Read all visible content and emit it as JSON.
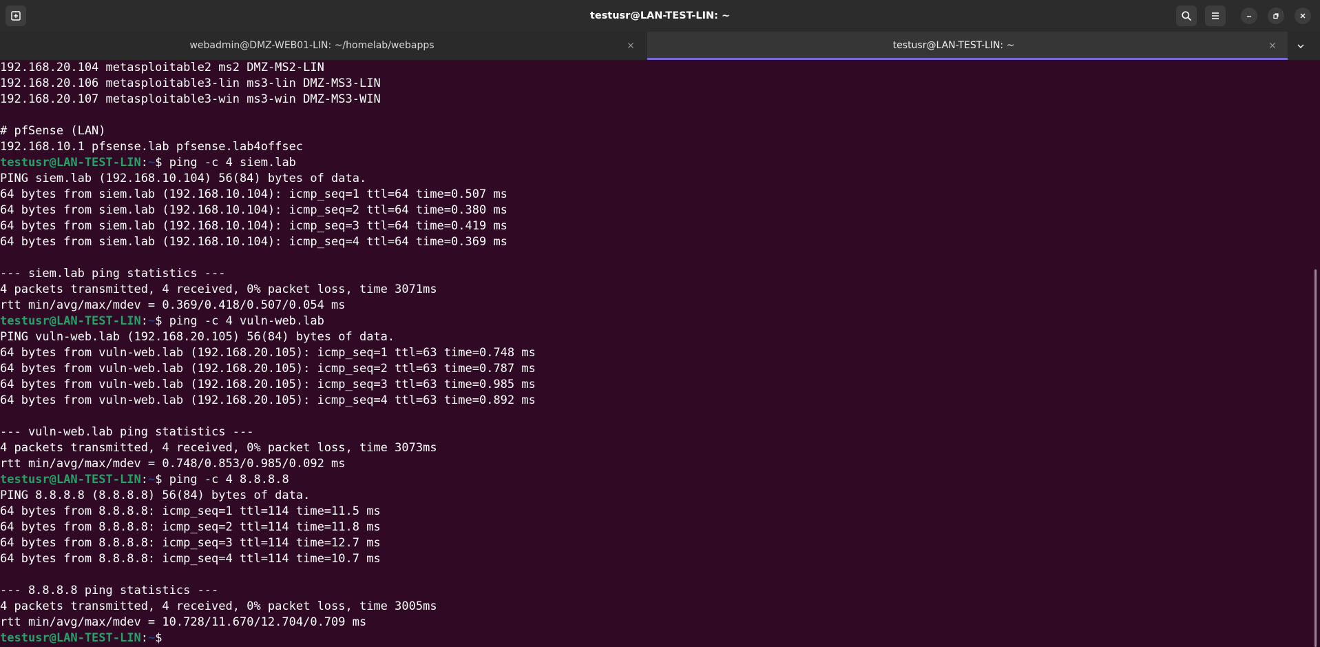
{
  "window": {
    "title": "testusr@LAN-TEST-LIN: ~"
  },
  "tabs": [
    {
      "label": "webadmin@DMZ-WEB01-LIN: ~/homelab/webapps",
      "active": false
    },
    {
      "label": "testusr@LAN-TEST-LIN: ~",
      "active": true
    }
  ],
  "icons": {
    "new_tab": "new-tab-icon",
    "search": "search-icon",
    "menu": "hamburger-menu-icon",
    "minimize": "minimize-icon",
    "maximize": "restore-icon",
    "close": "close-icon",
    "tab_close": "close-icon",
    "tab_overflow": "chevron-down-icon"
  },
  "colors": {
    "terminal_bg": "#300a24",
    "prompt_user": "#26a269",
    "prompt_path": "#12488b",
    "active_tab_indicator": "#7b68d8"
  },
  "prompt": {
    "user_host": "testusr@LAN-TEST-LIN",
    "separator": ":",
    "path": "~",
    "symbol": "$ "
  },
  "terminal": {
    "lines": [
      {
        "type": "out",
        "text": "192.168.20.104 metasploitable2 ms2 DMZ-MS2-LIN"
      },
      {
        "type": "out",
        "text": "192.168.20.106 metasploitable3-lin ms3-lin DMZ-MS3-LIN"
      },
      {
        "type": "out",
        "text": "192.168.20.107 metasploitable3-win ms3-win DMZ-MS3-WIN"
      },
      {
        "type": "out",
        "text": ""
      },
      {
        "type": "out",
        "text": "# pfSense (LAN)"
      },
      {
        "type": "out",
        "text": "192.168.10.1 pfsense.lab pfsense.lab4offsec"
      },
      {
        "type": "cmd",
        "text": "ping -c 4 siem.lab"
      },
      {
        "type": "out",
        "text": "PING siem.lab (192.168.10.104) 56(84) bytes of data."
      },
      {
        "type": "out",
        "text": "64 bytes from siem.lab (192.168.10.104): icmp_seq=1 ttl=64 time=0.507 ms"
      },
      {
        "type": "out",
        "text": "64 bytes from siem.lab (192.168.10.104): icmp_seq=2 ttl=64 time=0.380 ms"
      },
      {
        "type": "out",
        "text": "64 bytes from siem.lab (192.168.10.104): icmp_seq=3 ttl=64 time=0.419 ms"
      },
      {
        "type": "out",
        "text": "64 bytes from siem.lab (192.168.10.104): icmp_seq=4 ttl=64 time=0.369 ms"
      },
      {
        "type": "out",
        "text": ""
      },
      {
        "type": "out",
        "text": "--- siem.lab ping statistics ---"
      },
      {
        "type": "out",
        "text": "4 packets transmitted, 4 received, 0% packet loss, time 3071ms"
      },
      {
        "type": "out",
        "text": "rtt min/avg/max/mdev = 0.369/0.418/0.507/0.054 ms"
      },
      {
        "type": "cmd",
        "text": "ping -c 4 vuln-web.lab"
      },
      {
        "type": "out",
        "text": "PING vuln-web.lab (192.168.20.105) 56(84) bytes of data."
      },
      {
        "type": "out",
        "text": "64 bytes from vuln-web.lab (192.168.20.105): icmp_seq=1 ttl=63 time=0.748 ms"
      },
      {
        "type": "out",
        "text": "64 bytes from vuln-web.lab (192.168.20.105): icmp_seq=2 ttl=63 time=0.787 ms"
      },
      {
        "type": "out",
        "text": "64 bytes from vuln-web.lab (192.168.20.105): icmp_seq=3 ttl=63 time=0.985 ms"
      },
      {
        "type": "out",
        "text": "64 bytes from vuln-web.lab (192.168.20.105): icmp_seq=4 ttl=63 time=0.892 ms"
      },
      {
        "type": "out",
        "text": ""
      },
      {
        "type": "out",
        "text": "--- vuln-web.lab ping statistics ---"
      },
      {
        "type": "out",
        "text": "4 packets transmitted, 4 received, 0% packet loss, time 3073ms"
      },
      {
        "type": "out",
        "text": "rtt min/avg/max/mdev = 0.748/0.853/0.985/0.092 ms"
      },
      {
        "type": "cmd",
        "text": "ping -c 4 8.8.8.8"
      },
      {
        "type": "out",
        "text": "PING 8.8.8.8 (8.8.8.8) 56(84) bytes of data."
      },
      {
        "type": "out",
        "text": "64 bytes from 8.8.8.8: icmp_seq=1 ttl=114 time=11.5 ms"
      },
      {
        "type": "out",
        "text": "64 bytes from 8.8.8.8: icmp_seq=2 ttl=114 time=11.8 ms"
      },
      {
        "type": "out",
        "text": "64 bytes from 8.8.8.8: icmp_seq=3 ttl=114 time=12.7 ms"
      },
      {
        "type": "out",
        "text": "64 bytes from 8.8.8.8: icmp_seq=4 ttl=114 time=10.7 ms"
      },
      {
        "type": "out",
        "text": ""
      },
      {
        "type": "out",
        "text": "--- 8.8.8.8 ping statistics ---"
      },
      {
        "type": "out",
        "text": "4 packets transmitted, 4 received, 0% packet loss, time 3005ms"
      },
      {
        "type": "out",
        "text": "rtt min/avg/max/mdev = 10.728/11.670/12.704/0.709 ms"
      },
      {
        "type": "cmd",
        "text": ""
      }
    ]
  }
}
